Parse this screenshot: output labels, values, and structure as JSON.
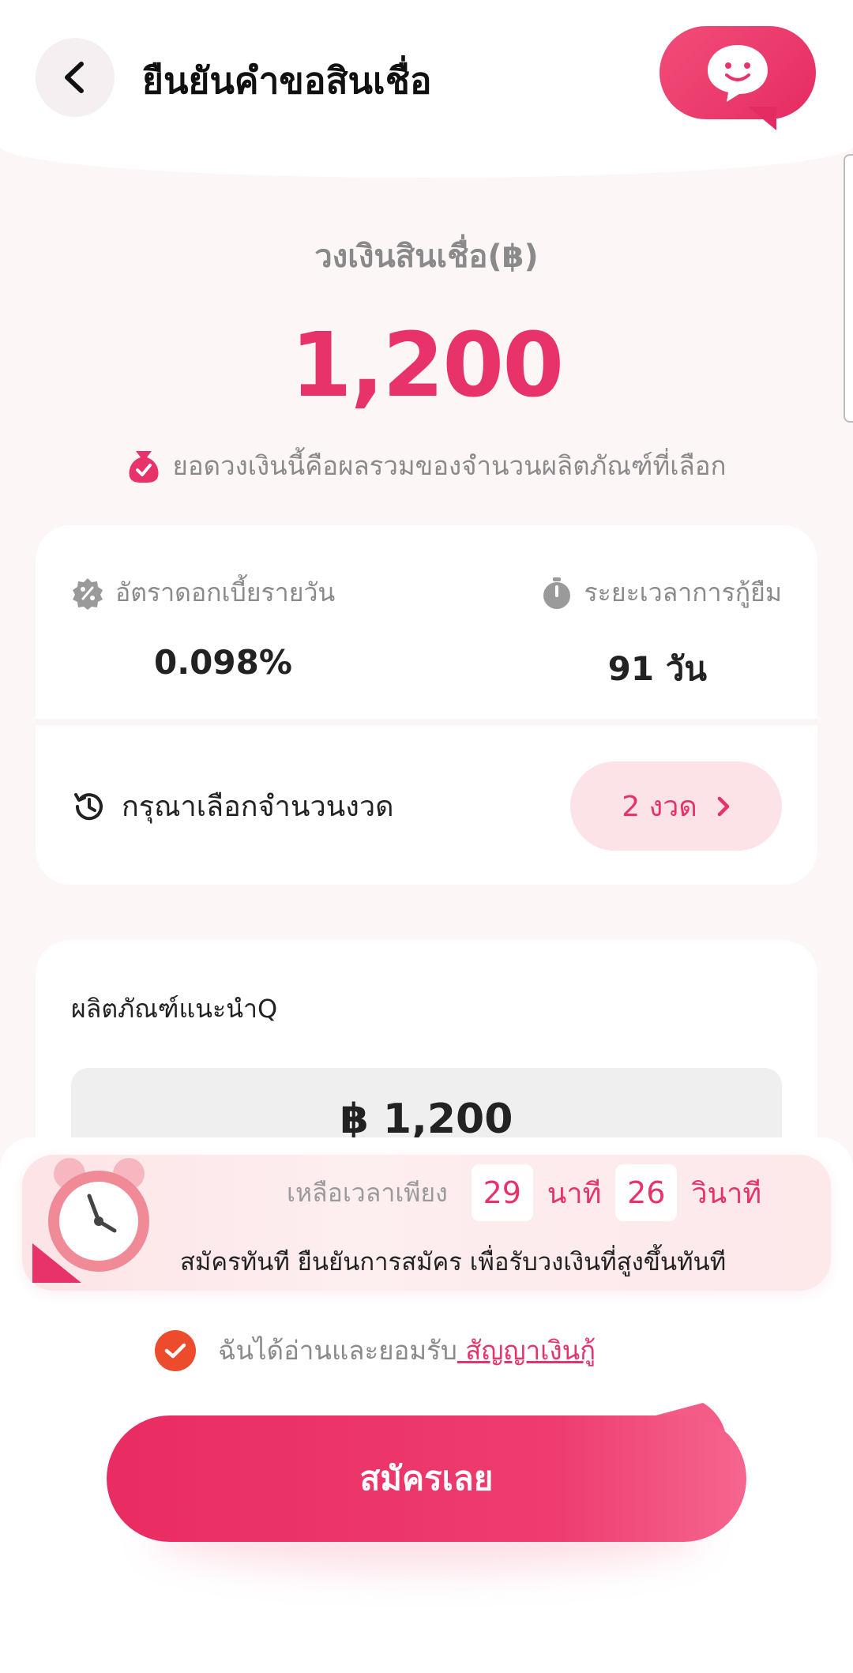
{
  "header": {
    "title": "ยืนยันคำขอสินเชื่อ",
    "back_icon": "chevron-left-icon",
    "support_icon": "chat-support-icon",
    "accent": "#e8336a"
  },
  "loan": {
    "label": "วงเงินสินเชื่อ(฿)",
    "amount": "1,200",
    "note": "ยอดวงเงินนี้คือผลรวมของจำนวนผลิตภัณฑ์ที่เลือก",
    "note_icon": "money-bag-icon"
  },
  "info": {
    "rate_label": "อัตราดอกเบี้ยรายวัน",
    "rate_value": "0.098%",
    "rate_icon": "percent-badge-icon",
    "term_label": "ระยะเวลาการกู้ยืม",
    "term_value": "91 วัน",
    "term_icon": "stopwatch-icon",
    "installment_label": "กรุณาเลือกจำนวนงวด",
    "installment_icon": "history-icon",
    "installment_value": "2 งวด"
  },
  "product": {
    "title": "ผลิตภัณฑ์แนะนำQ",
    "amount": "฿ 1,200"
  },
  "timer": {
    "prefix": "เหลือเวลาเพียง",
    "minutes": "29",
    "minutes_unit": "นาที",
    "seconds": "26",
    "seconds_unit": "วินาที",
    "subtitle": "สมัครทันที ยืนยันการสมัคร เพื่อรับวงเงินที่สูงขึ้นทันที",
    "icon": "alarm-clock-icon"
  },
  "agreement": {
    "text": "ฉันได้อ่านและยอมรับ",
    "link": " สัญญาเงินกู้",
    "checked": true
  },
  "apply": {
    "label": "สมัครเลย"
  }
}
